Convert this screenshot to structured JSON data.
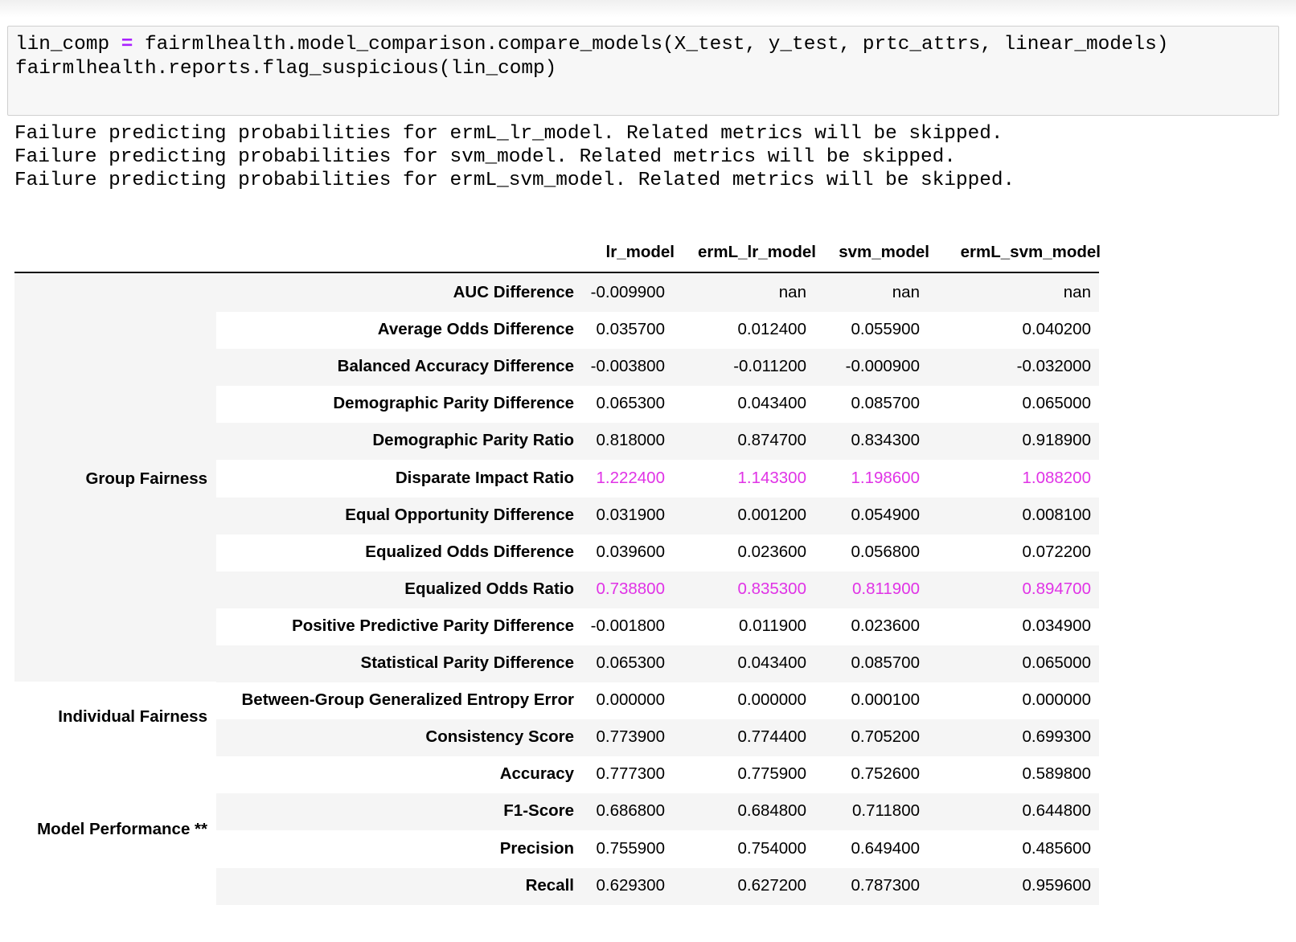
{
  "code": {
    "line1_var": "lin_comp",
    "line1_op": "=",
    "line1_call": "fairmlhealth.model_comparison.compare_models(X_test, y_test, prtc_attrs, linear_models)",
    "line2": "fairmlhealth.reports.flag_suspicious(lin_comp)"
  },
  "stdout": [
    "Failure predicting probabilities for ermL_lr_model. Related metrics will be skipped.",
    "Failure predicting probabilities for svm_model. Related metrics will be skipped.",
    "Failure predicting probabilities for ermL_svm_model. Related metrics will be skipped."
  ],
  "table": {
    "columns": [
      "lr_model",
      "ermL_lr_model",
      "svm_model",
      "ermL_svm_model"
    ],
    "groups": [
      {
        "label": "Group Fairness"
      },
      {
        "label": "Individual Fairness"
      },
      {
        "label": "Model Performance **"
      }
    ],
    "rows": [
      {
        "group": "Group Fairness",
        "metric": "AUC Difference",
        "values": [
          "-0.009900",
          "nan",
          "nan",
          "nan"
        ],
        "flagged": false
      },
      {
        "group": "Group Fairness",
        "metric": "Average Odds Difference",
        "values": [
          "0.035700",
          "0.012400",
          "0.055900",
          "0.040200"
        ],
        "flagged": false
      },
      {
        "group": "Group Fairness",
        "metric": "Balanced Accuracy Difference",
        "values": [
          "-0.003800",
          "-0.011200",
          "-0.000900",
          "-0.032000"
        ],
        "flagged": false
      },
      {
        "group": "Group Fairness",
        "metric": "Demographic Parity Difference",
        "values": [
          "0.065300",
          "0.043400",
          "0.085700",
          "0.065000"
        ],
        "flagged": false
      },
      {
        "group": "Group Fairness",
        "metric": "Demographic Parity Ratio",
        "values": [
          "0.818000",
          "0.874700",
          "0.834300",
          "0.918900"
        ],
        "flagged": false
      },
      {
        "group": "Group Fairness",
        "metric": "Disparate Impact Ratio",
        "values": [
          "1.222400",
          "1.143300",
          "1.198600",
          "1.088200"
        ],
        "flagged": true
      },
      {
        "group": "Group Fairness",
        "metric": "Equal Opportunity Difference",
        "values": [
          "0.031900",
          "0.001200",
          "0.054900",
          "0.008100"
        ],
        "flagged": false
      },
      {
        "group": "Group Fairness",
        "metric": "Equalized Odds Difference",
        "values": [
          "0.039600",
          "0.023600",
          "0.056800",
          "0.072200"
        ],
        "flagged": false
      },
      {
        "group": "Group Fairness",
        "metric": "Equalized Odds Ratio",
        "values": [
          "0.738800",
          "0.835300",
          "0.811900",
          "0.894700"
        ],
        "flagged": true
      },
      {
        "group": "Group Fairness",
        "metric": "Positive Predictive Parity Difference",
        "values": [
          "-0.001800",
          "0.011900",
          "0.023600",
          "0.034900"
        ],
        "flagged": false
      },
      {
        "group": "Group Fairness",
        "metric": "Statistical Parity Difference",
        "values": [
          "0.065300",
          "0.043400",
          "0.085700",
          "0.065000"
        ],
        "flagged": false
      },
      {
        "group": "Individual Fairness",
        "metric": "Between-Group Generalized Entropy Error",
        "values": [
          "0.000000",
          "0.000000",
          "0.000100",
          "0.000000"
        ],
        "flagged": false
      },
      {
        "group": "Individual Fairness",
        "metric": "Consistency Score",
        "values": [
          "0.773900",
          "0.774400",
          "0.705200",
          "0.699300"
        ],
        "flagged": false
      },
      {
        "group": "Model Performance **",
        "metric": "Accuracy",
        "values": [
          "0.777300",
          "0.775900",
          "0.752600",
          "0.589800"
        ],
        "flagged": false
      },
      {
        "group": "Model Performance **",
        "metric": "F1-Score",
        "values": [
          "0.686800",
          "0.684800",
          "0.711800",
          "0.644800"
        ],
        "flagged": false
      },
      {
        "group": "Model Performance **",
        "metric": "Precision",
        "values": [
          "0.755900",
          "0.754000",
          "0.649400",
          "0.485600"
        ],
        "flagged": false
      },
      {
        "group": "Model Performance **",
        "metric": "Recall",
        "values": [
          "0.629300",
          "0.627200",
          "0.787300",
          "0.959600"
        ],
        "flagged": false
      }
    ]
  },
  "colors": {
    "flag_text": "#e033e6",
    "operator": "#aa22ff",
    "row_stripe": "#f5f5f5",
    "code_cell_bg": "#f7f7f7"
  }
}
